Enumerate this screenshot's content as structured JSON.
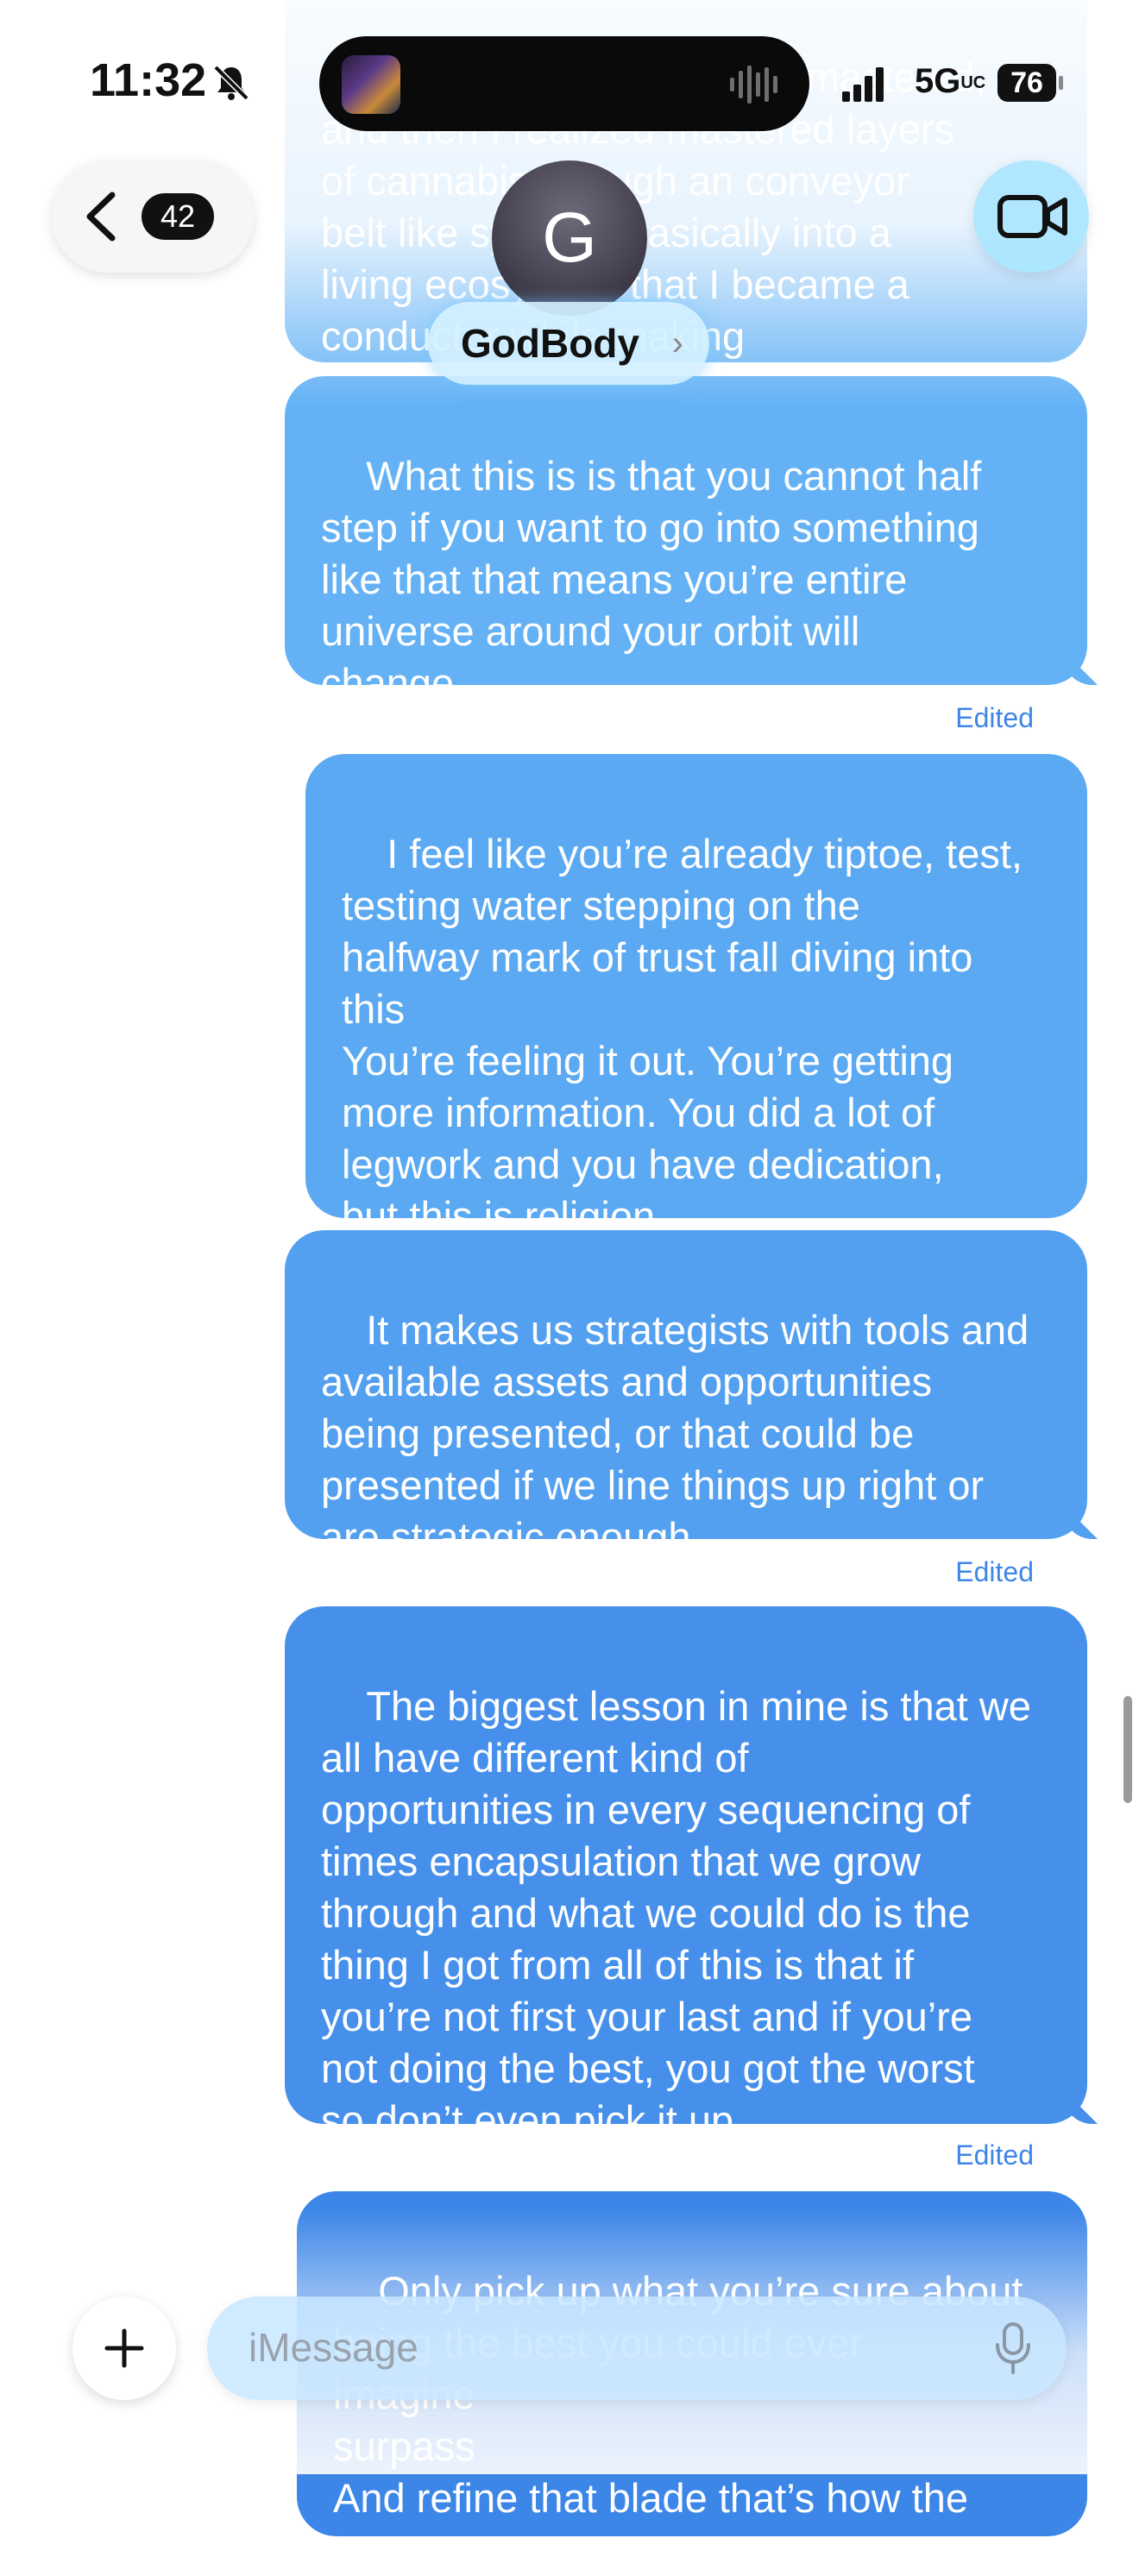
{
  "status_bar": {
    "time": "11:32",
    "network": "5G",
    "network_suffix": "UC",
    "battery": "76"
  },
  "header": {
    "back_count": "42",
    "avatar_letter": "G",
    "contact_name": "GodBody",
    "name_chevron": "›"
  },
  "messages": [
    {
      "text": "layers of cannabis to be mastered,\nand then I realized mastered layers\nof cannabis through an conveyor\nbelt like system. Basically into a\nliving ecosystem that I became a\nconductor while making\nbreakthroughs and teaching.",
      "edited": ""
    },
    {
      "text": "What this is is that you cannot half\nstep if you want to go into something\nlike that that means you’re entire\nuniverse around your orbit will\nchange",
      "edited": "Edited"
    },
    {
      "text": "I feel like you’re already tiptoe, test,\ntesting water stepping on the\nhalfway mark of trust fall diving into\nthis\nYou’re feeling it out. You’re getting\nmore information. You did a lot of\nlegwork and you have dedication,\nbut this is religion.",
      "edited": ""
    },
    {
      "text": "It makes us strategists with tools and\navailable assets and opportunities\nbeing presented, or that could be\npresented if we line things up right or\nare strategic enough",
      "edited": "Edited"
    },
    {
      "text": "The biggest lesson in mine is that we\nall have different kind of\nopportunities in every sequencing of\ntimes encapsulation that we grow\nthrough and what we could do is the\nthing I got from all of this is that if\nyou’re not first your last and if you’re\nnot doing the best, you got the worst\nso don’t even pick it up",
      "edited": "Edited"
    },
    {
      "text": "Only pick up what you’re sure about\nbeing the best you could ever\nimagine\nsurpass\nAnd refine that blade that’s how the",
      "edited": ""
    }
  ],
  "composer": {
    "placeholder": "iMessage"
  },
  "icons": {
    "bell": "bell-slash-icon",
    "wave": "audio-wave-icon",
    "signal": "cellular-signal-icon",
    "back": "chevron-left-icon",
    "video": "video-camera-icon",
    "add": "plus-icon",
    "mic": "microphone-icon"
  },
  "colors": {
    "bubble_top": "#5eaef4",
    "bubble_bottom": "#2f7ae6",
    "edited_text": "#3f86e6",
    "name_glow": "#78c8ff"
  }
}
